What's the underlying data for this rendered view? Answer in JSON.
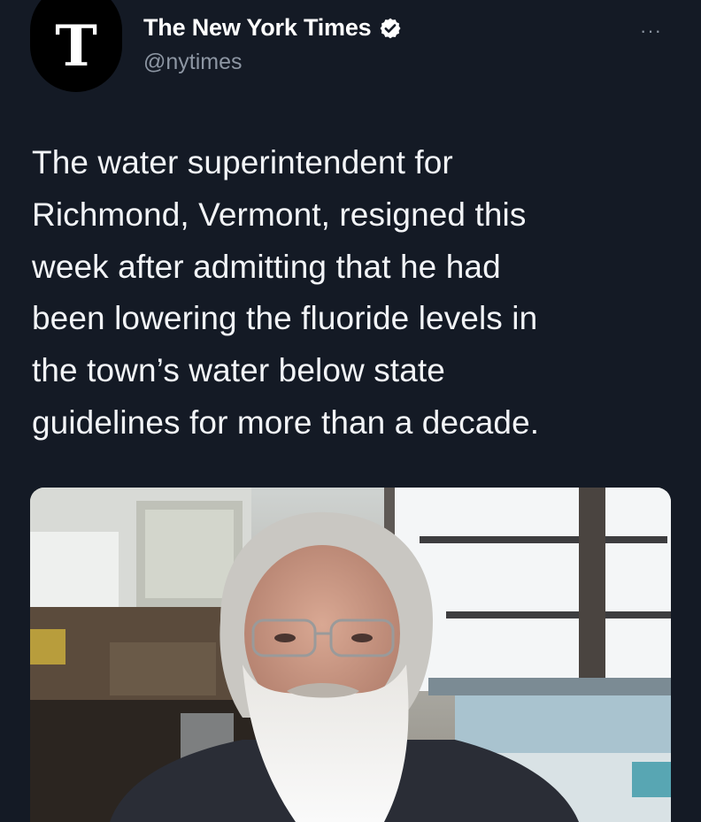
{
  "account": {
    "avatar_letter": "T",
    "display_name": "The New York Times",
    "handle": "@nytimes",
    "verified_icon": "verified-badge-icon"
  },
  "menu": {
    "more_label": "···"
  },
  "tweet": {
    "text": "The water superintendent for\nRichmond, Vermont, resigned this\nweek after admitting that he had\nbeen lowering the fluoride levels in\nthe town’s water below state\nguidelines for more than a decade."
  },
  "media": {
    "description_icon": "photo-icon"
  },
  "colors": {
    "background": "#141a25",
    "secondary_text": "#8d96a3",
    "primary_text": "#f2f4f7"
  }
}
